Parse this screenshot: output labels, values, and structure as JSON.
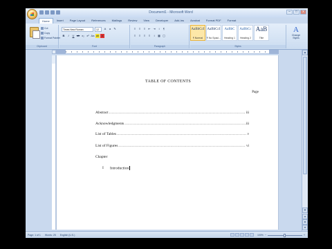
{
  "window": {
    "title": "Document1 - Microsoft Word",
    "controls": [
      "–",
      "□",
      "x"
    ]
  },
  "tabs": [
    {
      "label": "Home",
      "active": true
    },
    {
      "label": "Insert"
    },
    {
      "label": "Page Layout"
    },
    {
      "label": "References"
    },
    {
      "label": "Mailings"
    },
    {
      "label": "Review"
    },
    {
      "label": "View"
    },
    {
      "label": "Developer"
    },
    {
      "label": "Add-Ins"
    },
    {
      "label": "Acrobat"
    },
    {
      "label": "Format PDF"
    },
    {
      "label": "Format"
    }
  ],
  "ribbon": {
    "clipboard": {
      "cut": "Cut",
      "copy": "Copy",
      "format_painter": "Format Painter",
      "label": "Clipboard"
    },
    "font": {
      "family": "Times New Roman",
      "size": "12",
      "label": "Font"
    },
    "paragraph": {
      "label": "Paragraph"
    },
    "styles": {
      "items": [
        {
          "sample": "AaBbCcI",
          "name": "¶ Normal",
          "selected": true
        },
        {
          "sample": "AaBbCcI",
          "name": "¶ No Spaci..."
        },
        {
          "sample": "AaBbC",
          "name": "Heading 1",
          "blue": true
        },
        {
          "sample": "AaBbCc",
          "name": "Heading 2",
          "blue": true
        },
        {
          "sample": "AaB",
          "name": "Title",
          "big": true
        },
        {
          "sample": "AaBbCcI",
          "name": "Subtitle"
        }
      ],
      "label": "Styles",
      "change_styles": "Change Styles"
    },
    "editing": {
      "find": "Find",
      "replace": "Replace",
      "select": "Select",
      "label": "Editing"
    }
  },
  "document": {
    "toc_title": "TABLE OF CONTENTS",
    "page_header": "Page",
    "entries": [
      {
        "label": "Abstract",
        "dots": "................................................................................................................................",
        "page": "iii"
      },
      {
        "label": "Acknowledgments",
        "dots": "................................................................................................................................",
        "page": "iii"
      },
      {
        "label": "List of Tables",
        "dots": "................................................................................................................................",
        "page": "v"
      },
      {
        "label": "List of Figures",
        "dots": "................................................................................................................................",
        "page": "vi"
      }
    ],
    "chapter_label": "Chapter",
    "chapter_item": {
      "numeral": "I",
      "title": "Introduction"
    }
  },
  "statusbar": {
    "page": "Page: 1 of 1",
    "words": "Words: 25",
    "language": "English (U.S.)",
    "zoom": "100%",
    "zoom_fraction": 0.5
  }
}
